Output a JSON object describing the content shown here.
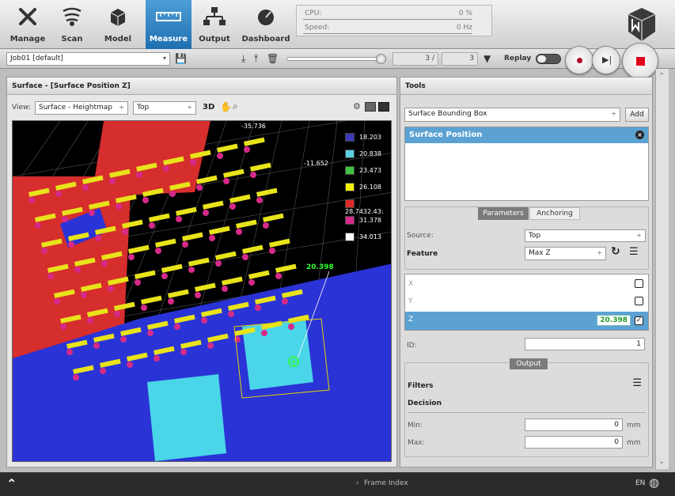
{
  "nav": {
    "items": [
      {
        "label": "Manage",
        "icon": "tools-icon"
      },
      {
        "label": "Scan",
        "icon": "scan-icon"
      },
      {
        "label": "Model",
        "icon": "model-icon"
      },
      {
        "label": "Measure",
        "icon": "ruler-icon"
      },
      {
        "label": "Output",
        "icon": "network-icon"
      },
      {
        "label": "Dashboard",
        "icon": "gauge-icon"
      }
    ],
    "active": "Measure"
  },
  "stats": {
    "cpu_label": "CPU:",
    "cpu_value": "0 %",
    "speed_label": "Speed:",
    "speed_value": "0 Hz"
  },
  "toolbar": {
    "job": "Job01 [default]",
    "frame_current": "3 /",
    "frame_total": "3",
    "replay_label": "Replay"
  },
  "left": {
    "title": "Surface - [Surface Position Z]",
    "view_label": "View:",
    "view_mode": "Surface - Heightmap",
    "view_source": "Top",
    "mode_3d": "3D"
  },
  "scene": {
    "annotations": [
      "-35.736",
      "-11.652",
      "20.398"
    ],
    "legend": [
      {
        "value": "18.203",
        "color": "#3a3ab8"
      },
      {
        "value": "20.838",
        "color": "#5ad0e0"
      },
      {
        "value": "23.473",
        "color": "#3fc23f"
      },
      {
        "value": "26.108",
        "color": "#f2f200"
      },
      {
        "value": "28.743",
        "color": "#e02a2a"
      },
      {
        "value": "31.378",
        "color": "#d62a8a"
      },
      {
        "value": "34.013",
        "color": "#ffffff"
      }
    ],
    "overlap_label": "2.43:"
  },
  "tools": {
    "title": "Tools",
    "tool_select": "Surface Bounding Box",
    "add_label": "Add",
    "selected_tool": "Surface Position",
    "tab_parameters": "Parameters",
    "tab_anchoring": "Anchoring",
    "source_label": "Source:",
    "source_value": "Top",
    "feature_label": "Feature",
    "feature_value": "Max Z",
    "x_label": "X",
    "y_label": "Y",
    "z_label": "Z",
    "z_value": "20.398",
    "id_label": "ID:",
    "id_value": "1",
    "output_tab": "Output",
    "filters_label": "Filters",
    "decision_label": "Decision",
    "min_label": "Min:",
    "min_value": "0",
    "max_label": "Max:",
    "max_value": "0",
    "unit": "mm"
  },
  "status": {
    "frame_index": "Frame Index",
    "language": "EN"
  },
  "colors": {
    "accent": "#2b7cc0",
    "highlight_row": "#5ba2d3",
    "z_value_color": "#1f9a2b"
  }
}
